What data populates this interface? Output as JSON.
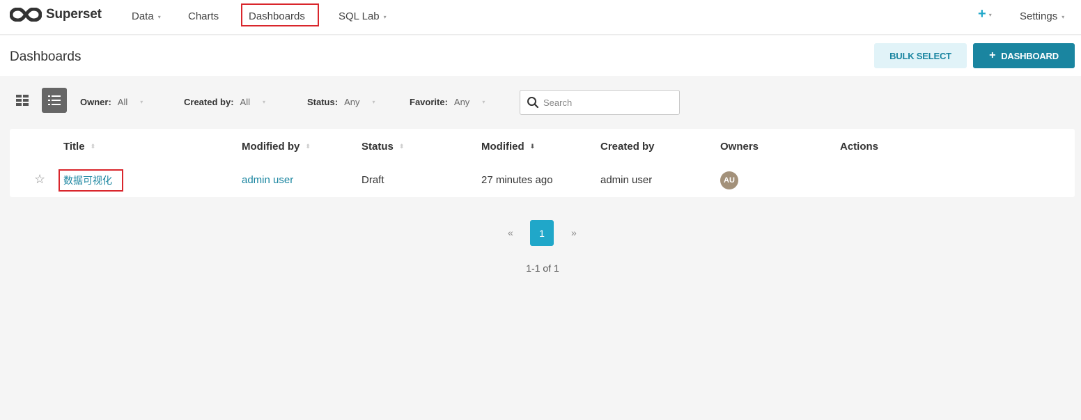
{
  "nav": {
    "brand": "Superset",
    "items": [
      {
        "label": "Data",
        "dropdown": true
      },
      {
        "label": "Charts",
        "dropdown": false
      },
      {
        "label": "Dashboards",
        "dropdown": false,
        "active": true
      },
      {
        "label": "SQL Lab",
        "dropdown": true
      }
    ],
    "plus_icon": "+",
    "settings_label": "Settings",
    "caret": "▾"
  },
  "header": {
    "title": "Dashboards",
    "bulk_select_label": "BULK SELECT",
    "add_dashboard_label": "DASHBOARD",
    "add_icon": "+"
  },
  "filters": {
    "owner": {
      "label": "Owner:",
      "value": "All"
    },
    "created_by": {
      "label": "Created by:",
      "value": "All"
    },
    "status": {
      "label": "Status:",
      "value": "Any"
    },
    "favorite": {
      "label": "Favorite:",
      "value": "Any"
    },
    "search_placeholder": "Search",
    "caret": "▾"
  },
  "table": {
    "columns": [
      "Title",
      "Modified by",
      "Status",
      "Modified",
      "Created by",
      "Owners",
      "Actions"
    ],
    "sort_glyph": "⬍",
    "sort_active_glyph": "⬇",
    "rows": [
      {
        "star": "☆",
        "title": "数据可视化",
        "modified_by": "admin user",
        "status": "Draft",
        "modified": "27 minutes ago",
        "created_by": "admin user",
        "owner_initials": "AU"
      }
    ]
  },
  "pagination": {
    "prev": "«",
    "current_page": "1",
    "next": "»",
    "count_text": "1-1 of 1"
  },
  "colors": {
    "accent": "#20a7c9",
    "primary_button": "#1a85a0",
    "highlight_box": "#d9262c",
    "avatar": "#a3917a"
  }
}
